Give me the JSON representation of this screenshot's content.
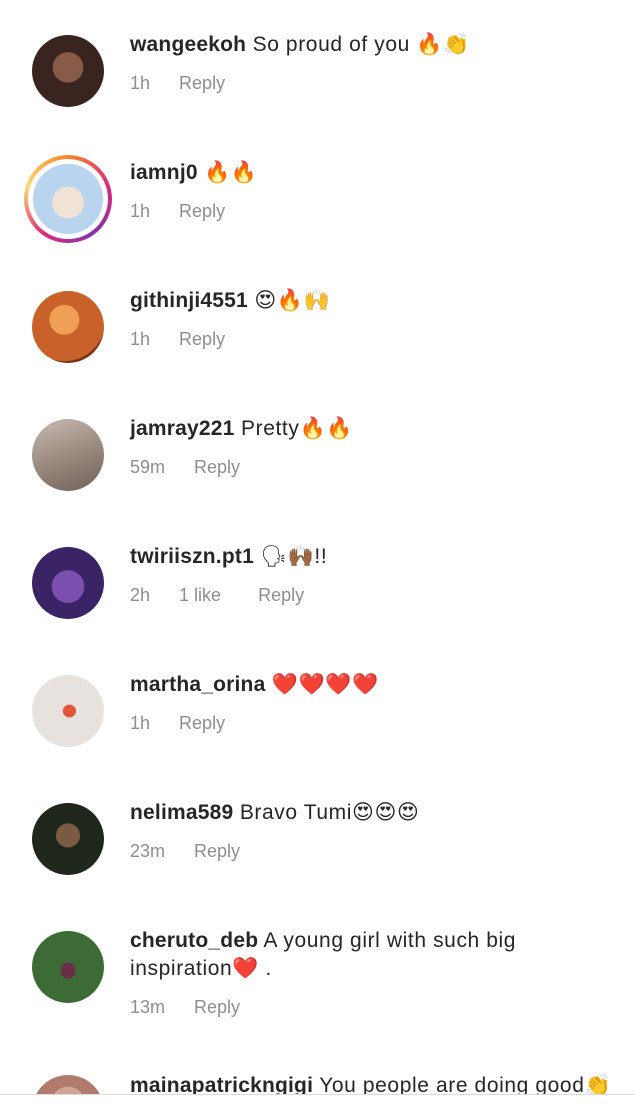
{
  "comments": [
    {
      "username": "wangeekoh",
      "text": "So proud of you 🔥👏",
      "time": "1h",
      "likes": "",
      "reply": "Reply",
      "avatar_color": "#3a2420",
      "has_story": false
    },
    {
      "username": "iamnj0",
      "text": "🔥🔥",
      "time": "1h",
      "likes": "",
      "reply": "Reply",
      "avatar_color": "#b9d4ee",
      "has_story": true
    },
    {
      "username": "githinji4551",
      "text": "😍🔥🙌",
      "time": "1h",
      "likes": "",
      "reply": "Reply",
      "avatar_color": "#c8612a",
      "has_story": false
    },
    {
      "username": "jamray221",
      "text": "Pretty🔥🔥",
      "time": "59m",
      "likes": "",
      "reply": "Reply",
      "avatar_color": "#9b8a7f",
      "has_story": false
    },
    {
      "username": "twiriiszn.pt1",
      "text": "🗣🙌🏾!!",
      "time": "2h",
      "likes": "1 like",
      "reply": "Reply",
      "avatar_color": "#3a2465",
      "has_story": false
    },
    {
      "username": "martha_orina",
      "text": "❤️❤️❤️❤️",
      "time": "1h",
      "likes": "",
      "reply": "Reply",
      "avatar_color": "#e7e2de",
      "has_story": false
    },
    {
      "username": "nelima589",
      "text": "Bravo Tumi😍😍😍",
      "time": "23m",
      "likes": "",
      "reply": "Reply",
      "avatar_color": "#1f261c",
      "has_story": false
    },
    {
      "username": "cheruto_deb",
      "text": "A young girl with such big inspiration❤️ .",
      "time": "13m",
      "likes": "",
      "reply": "Reply",
      "avatar_color": "#3c6b35",
      "has_story": false
    },
    {
      "username": "mainapatrickngigi",
      "text": "You people are doing good👏",
      "time": "",
      "likes": "",
      "reply": "",
      "avatar_color": "#b07a6c",
      "has_story": false
    }
  ]
}
